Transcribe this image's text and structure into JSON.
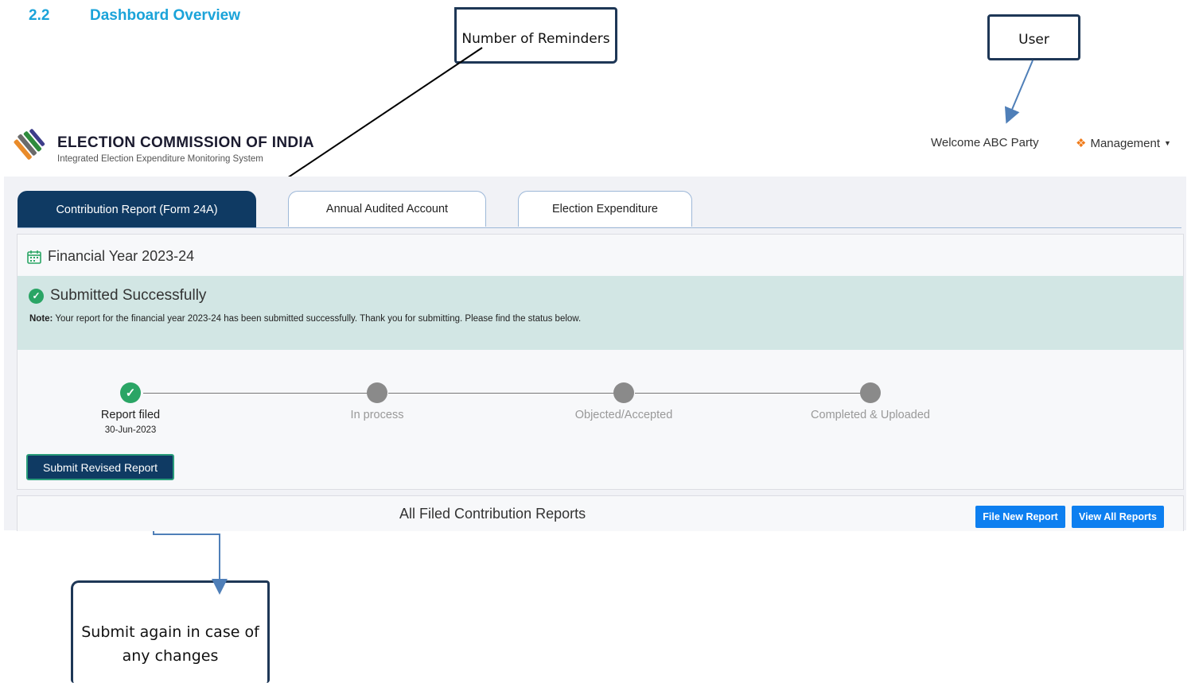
{
  "doc": {
    "section_num": "2.2",
    "section_title": "Dashboard Overview"
  },
  "callouts": {
    "reminders": "Number of Reminders",
    "user": "User",
    "resubmit": "Submit again in case of any changes"
  },
  "header": {
    "org_title": "ELECTION COMMISSION OF INDIA",
    "org_subtitle": "Integrated Election Expenditure Monitoring System",
    "welcome": "Welcome ABC Party",
    "menu_label": "Management"
  },
  "tabs": [
    {
      "label": "Contribution Report (Form 24A)",
      "active": true
    },
    {
      "label": "Annual Audited Account",
      "active": false
    },
    {
      "label": "Election Expenditure",
      "active": false
    }
  ],
  "card": {
    "fy_label": "Financial Year 2023-24",
    "alert_title": "Submitted Successfully",
    "note_prefix": "Note:",
    "note_text": " Your report for the financial year 2023-24 has been submitted successfully. Thank you for submitting. Please find the status below."
  },
  "steps": [
    {
      "label": "Report filed",
      "date": "30-Jun-2023",
      "done": true
    },
    {
      "label": "In process",
      "date": "",
      "done": false
    },
    {
      "label": "Objected/Accepted",
      "date": "",
      "done": false
    },
    {
      "label": "Completed & Uploaded",
      "date": "",
      "done": false
    }
  ],
  "actions": {
    "revise_label": "Submit Revised Report",
    "reports_title": "All Filed Contribution Reports",
    "file_new_label": "File New Report",
    "view_all_label": "View All Reports"
  },
  "colors": {
    "heading": "#1aa3d9",
    "primary": "#0f3a63",
    "success": "#2aa565",
    "alert_bg": "#d2e6e4",
    "blue_button": "#0d7ff0"
  }
}
